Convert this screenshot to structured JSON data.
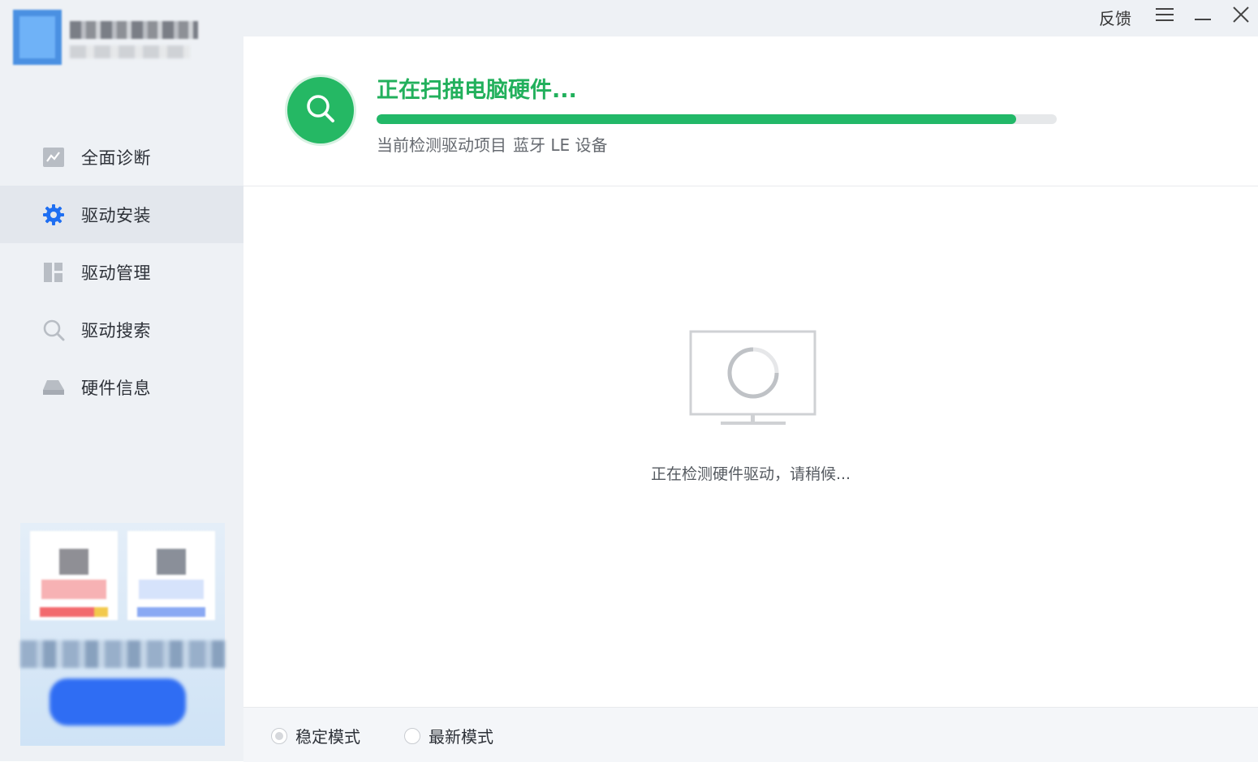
{
  "sidebar": {
    "nav": [
      {
        "label": "全面诊断",
        "icon": "diagnosis-chart-icon"
      },
      {
        "label": "驱动安装",
        "icon": "gear-icon",
        "active": true
      },
      {
        "label": "驱动管理",
        "icon": "grid-manage-icon"
      },
      {
        "label": "驱动搜索",
        "icon": "search-icon"
      },
      {
        "label": "硬件信息",
        "icon": "hardware-drive-icon"
      }
    ]
  },
  "titlebar": {
    "feedback_label": "反馈"
  },
  "scan": {
    "title": "正在扫描电脑硬件...",
    "progress": 0.94,
    "current_label": "当前检测驱动项目",
    "current_device": "蓝牙 LE 设备",
    "accent_color": "#22b05c"
  },
  "content": {
    "waiting_text": "正在检测硬件驱动，请稍候..."
  },
  "footer": {
    "modes": [
      {
        "label": "稳定模式",
        "selected": true
      },
      {
        "label": "最新模式",
        "selected": false
      }
    ]
  }
}
